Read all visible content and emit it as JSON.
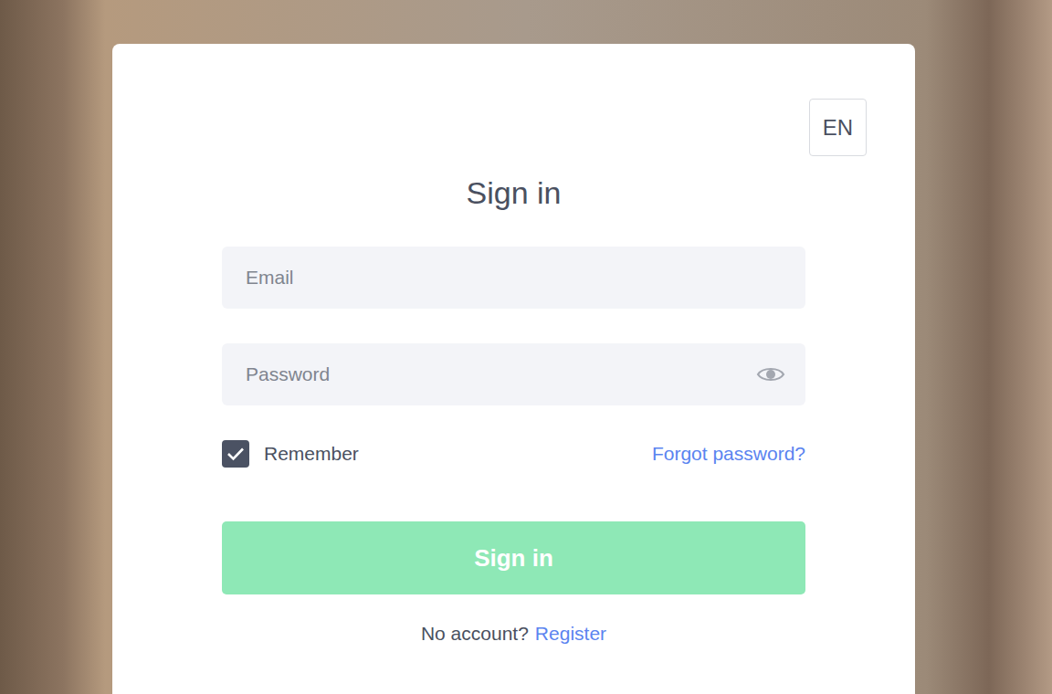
{
  "language": {
    "label": "EN"
  },
  "title": "Sign in",
  "fields": [
    {
      "placeholder": "Email",
      "kind": "text"
    },
    {
      "placeholder": "Password",
      "kind": "password"
    }
  ],
  "remember": {
    "label": "Remember",
    "checked": true
  },
  "forgot_link": "Forgot password?",
  "submit": {
    "label": "Sign in",
    "disabled": true
  },
  "register": {
    "prompt": "No account?",
    "link": "Register"
  }
}
